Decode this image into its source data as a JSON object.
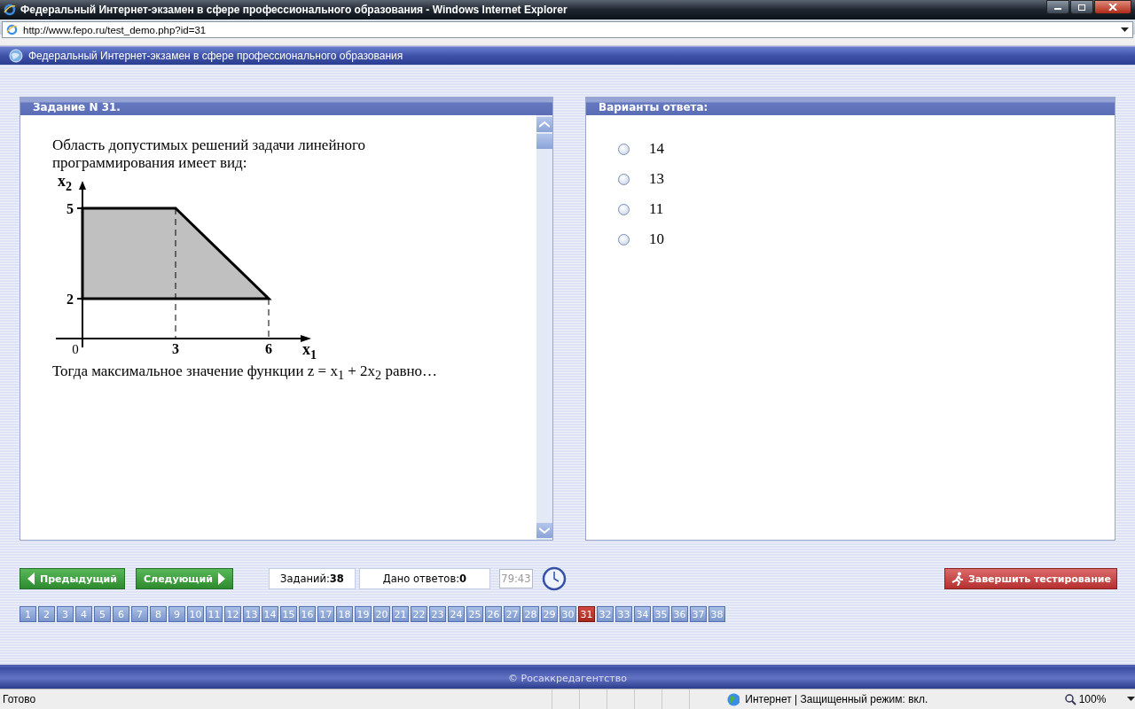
{
  "window": {
    "title": "Федеральный Интернет-экзамен в сфере профессионального образования - Windows Internet Explorer"
  },
  "address_bar": {
    "url": "http://www.fepo.ru/test_demo.php?id=31"
  },
  "page_tab": {
    "title": "Федеральный Интернет-экзамен в сфере профессионального образования"
  },
  "question": {
    "header": "Задание N 31.",
    "intro": "Область допустимых решений задачи линейного программирования имеет вид:",
    "figure": {
      "x_axis": {
        "name": "x",
        "index": "1"
      },
      "y_axis": {
        "name": "x",
        "index": "2"
      },
      "x_ticks": [
        "0",
        "3",
        "6"
      ],
      "y_ticks": [
        "5",
        "2"
      ]
    },
    "prompt": "Тогда максимальное значение функции z = x$_{1}$ + 2x$_{2}$ равно…"
  },
  "answers": {
    "header": "Варианты ответа:",
    "options": [
      {
        "label": "14",
        "selected": false
      },
      {
        "label": "13",
        "selected": false
      },
      {
        "label": "11",
        "selected": false
      },
      {
        "label": "10",
        "selected": false
      }
    ]
  },
  "nav": {
    "prev": "Предыдущий",
    "next": "Следующий",
    "tasks_label": "Заданий:",
    "tasks_count": "38",
    "answered_label": "Дано ответов:",
    "answered_count": "0",
    "timer": "79:43",
    "finish": "Завершить тестирование"
  },
  "questions": [
    {
      "label": "1",
      "selected": false
    },
    {
      "label": "2",
      "selected": false
    },
    {
      "label": "3",
      "selected": false
    },
    {
      "label": "4",
      "selected": false
    },
    {
      "label": "5",
      "selected": false
    },
    {
      "label": "6",
      "selected": false
    },
    {
      "label": "7",
      "selected": false
    },
    {
      "label": "8",
      "selected": false
    },
    {
      "label": "9",
      "selected": false
    },
    {
      "label": "10",
      "selected": false
    },
    {
      "label": "11",
      "selected": false
    },
    {
      "label": "12",
      "selected": false
    },
    {
      "label": "13",
      "selected": false
    },
    {
      "label": "14",
      "selected": false
    },
    {
      "label": "15",
      "selected": false
    },
    {
      "label": "16",
      "selected": false
    },
    {
      "label": "17",
      "selected": false
    },
    {
      "label": "18",
      "selected": false
    },
    {
      "label": "19",
      "selected": false
    },
    {
      "label": "20",
      "selected": false
    },
    {
      "label": "21",
      "selected": false
    },
    {
      "label": "22",
      "selected": false
    },
    {
      "label": "23",
      "selected": false
    },
    {
      "label": "24",
      "selected": false
    },
    {
      "label": "25",
      "selected": false
    },
    {
      "label": "26",
      "selected": false
    },
    {
      "label": "27",
      "selected": false
    },
    {
      "label": "28",
      "selected": false
    },
    {
      "label": "29",
      "selected": false
    },
    {
      "label": "30",
      "selected": false
    },
    {
      "label": "31",
      "selected": true
    },
    {
      "label": "32",
      "selected": false
    },
    {
      "label": "33",
      "selected": false
    },
    {
      "label": "34",
      "selected": false
    },
    {
      "label": "35",
      "selected": false
    },
    {
      "label": "36",
      "selected": false
    },
    {
      "label": "37",
      "selected": false
    },
    {
      "label": "38",
      "selected": false
    }
  ],
  "footer": "© Росаккредагентство",
  "status_bar": {
    "status": "Готово",
    "zone": "Интернет | Защищенный режим: вкл.",
    "zoom": "100%"
  }
}
